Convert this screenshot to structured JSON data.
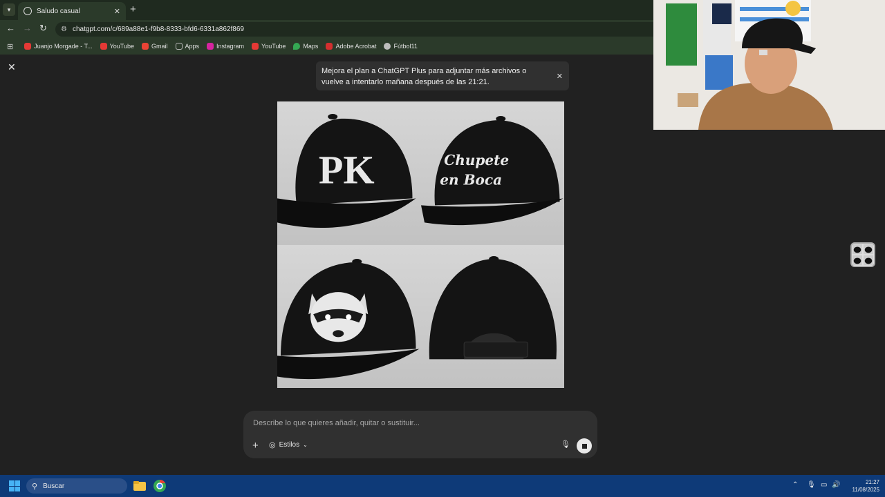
{
  "browser": {
    "tab_title": "Saludo casual",
    "url": "chatgpt.com/c/689a88e1-f9b8-8333-bfd6-6331a862f869",
    "bookmarks": [
      {
        "label": "Juanjo Morgade - T...",
        "color": "#e53935"
      },
      {
        "label": "YouTube",
        "color": "#e53935"
      },
      {
        "label": "Gmail",
        "color": "#ea4335"
      },
      {
        "label": "Apps",
        "color": "#9e9e9e"
      },
      {
        "label": "Instagram",
        "color": "#d6249f"
      },
      {
        "label": "YouTube",
        "color": "#e53935"
      },
      {
        "label": "Maps",
        "color": "#34a853"
      },
      {
        "label": "Adobe Acrobat",
        "color": "#d32f2f"
      },
      {
        "label": "Fútbol11",
        "color": "#bdbdbd"
      }
    ]
  },
  "chat": {
    "notice_text": "Mejora el plan a ChatGPT Plus para adjuntar más archivos o vuelve a intentarlo mañana después de las 21:21.",
    "caps": [
      {
        "label": "PK"
      },
      {
        "label": "Chupete en Boca"
      },
      {
        "label": "raccoon-logo"
      },
      {
        "label": "back-view"
      }
    ],
    "prompt_placeholder": "Describe lo que quieres añadir, quitar o sustituir...",
    "estilos_label": "Estilos"
  },
  "taskbar": {
    "search_label": "Buscar",
    "time": "21:27",
    "date": "11/08/2025"
  },
  "colors": {
    "browser_frame": "#2b3a2a",
    "page_bg": "#212121",
    "taskbar": "#0e3a78"
  }
}
